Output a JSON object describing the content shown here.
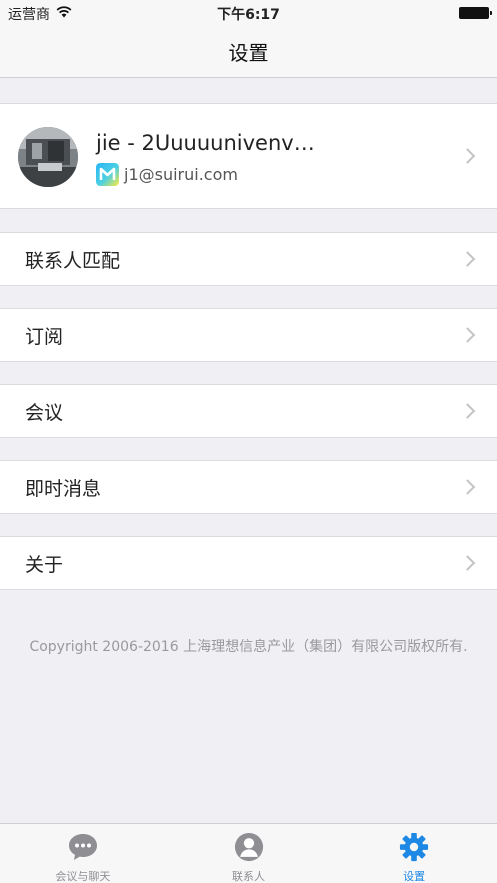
{
  "status_bar": {
    "carrier": "运营商",
    "time": "下午6:17"
  },
  "nav": {
    "title": "设置"
  },
  "profile": {
    "name": "jie - 2Uuuuunivenv…",
    "email": "j1@suirui.com"
  },
  "menu": {
    "items": [
      {
        "label": "联系人匹配"
      },
      {
        "label": "订阅"
      },
      {
        "label": "会议"
      },
      {
        "label": "即时消息"
      },
      {
        "label": "关于"
      }
    ]
  },
  "footer": {
    "copyright": "Copyright 2006-2016 上海理想信息产业（集团）有限公司版权所有."
  },
  "tabs": [
    {
      "label": "会议与聊天",
      "icon": "chat-bubble-icon",
      "active": false
    },
    {
      "label": "联系人",
      "icon": "contact-icon",
      "active": false
    },
    {
      "label": "设置",
      "icon": "gear-icon",
      "active": true
    }
  ],
  "colors": {
    "accent": "#1e88e5",
    "background": "#efeff4",
    "inactive_tab": "#8e8e93"
  }
}
